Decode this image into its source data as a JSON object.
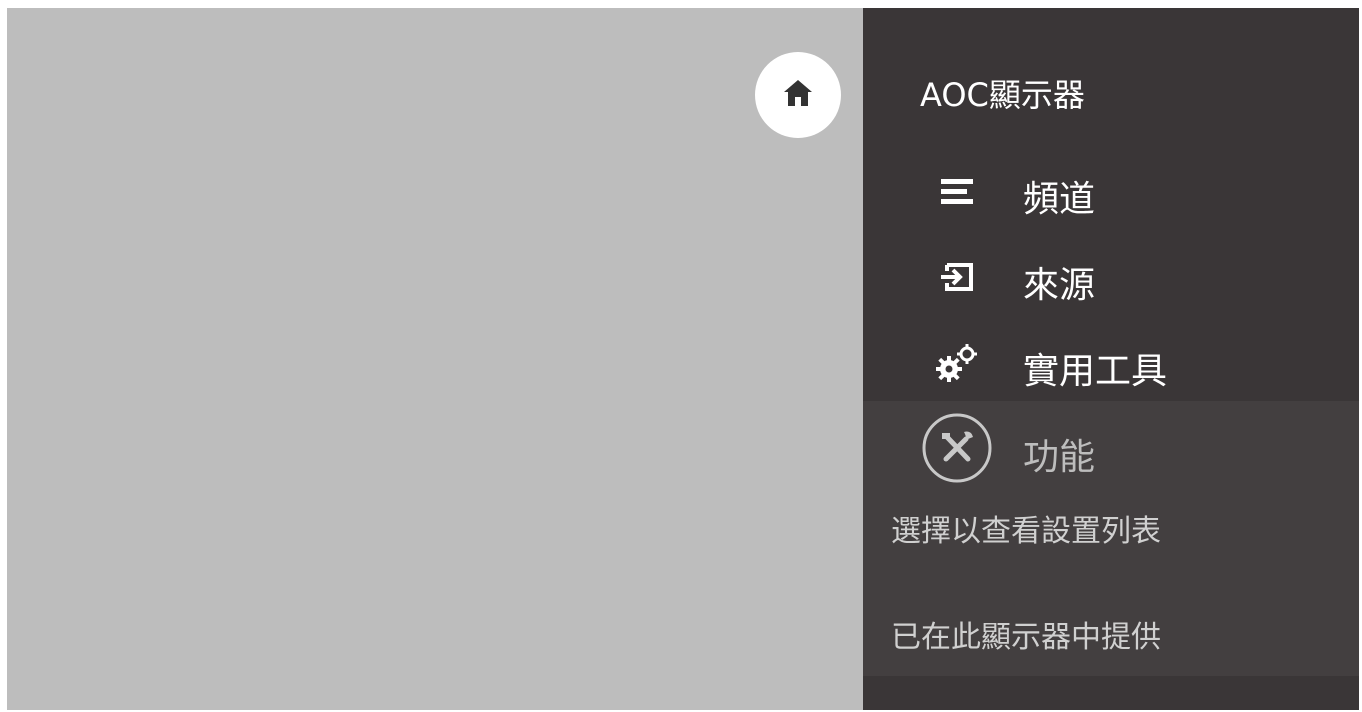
{
  "home": {
    "icon": "home-icon"
  },
  "panel": {
    "title": "AOC顯示器",
    "items": [
      {
        "label": "頻道",
        "icon": "list-icon"
      },
      {
        "label": "來源",
        "icon": "input-source-icon"
      },
      {
        "label": "實用工具",
        "icon": "gears-icon"
      },
      {
        "label": "功能",
        "icon": "tools-icon"
      }
    ],
    "description": "選擇以查看設置列表",
    "availability": "已在此顯示器中提供"
  },
  "colors": {
    "content_bg": "#bdbdbd",
    "panel_bg": "#3a3637",
    "panel_highlight": "#433f40",
    "text": "#ffffff",
    "dim_text": "#bdbdbd"
  }
}
